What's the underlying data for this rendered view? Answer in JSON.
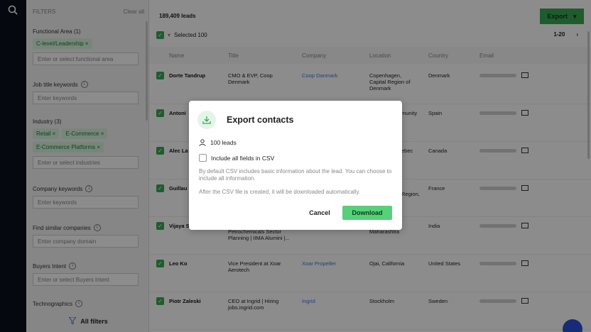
{
  "rail": {
    "icon": "search-icon"
  },
  "filters": {
    "title": "FILTERS",
    "clear_all": "Clear all",
    "functional_area": {
      "label": "Functional Area (1)",
      "chips": [
        "C-level/Leadership"
      ],
      "placeholder": "Enter or select functional area"
    },
    "job_title": {
      "label": "Job title keywords",
      "placeholder": "Enter keywords"
    },
    "industry": {
      "label": "Industry (3)",
      "chips": [
        "Retail",
        "E-Commerce",
        "E-Commerce Platforms"
      ],
      "placeholder": "Enter or select industries"
    },
    "company_keywords": {
      "label": "Company keywords",
      "placeholder": "Enter keywords"
    },
    "similar_companies": {
      "label": "Find similar companies",
      "placeholder": "Enter company domain"
    },
    "buyers_intent": {
      "label": "Buyers Intent",
      "placeholder": "Enter or select Buyers Intent"
    },
    "technographics": {
      "label": "Technographics"
    },
    "all_filters": "All filters"
  },
  "main": {
    "lead_count": "189,409 leads",
    "export_label": "Export",
    "selected_label": "Selected 100",
    "pager": "1-20",
    "columns": [
      "Name",
      "Title",
      "Company",
      "Location",
      "Country",
      "Email"
    ],
    "rows": [
      {
        "name": "Dorte Tandrup",
        "title": "CMO & EVP, Coop Denmark",
        "company": "Coop Danmark",
        "location": "Copenhagen, Capital Region of Denmark",
        "country": "Denmark"
      },
      {
        "name": "Antoni",
        "title": "",
        "company": "",
        "location": "munity",
        "country": "Spain"
      },
      {
        "name": "Alec La",
        "title": "",
        "company": "",
        "location": "ebec",
        "country": "Canada"
      },
      {
        "name": "Guillau",
        "title": "",
        "company": "",
        "location": "Region,",
        "country": "France"
      },
      {
        "name": "Vijaya S",
        "title": "Petrochemicals Sector Planning | IIMA Alumini |...",
        "company": "",
        "location": "Maharashtra",
        "country": "India"
      },
      {
        "name": "Leo Ko",
        "title": "Vice President at Xoar Aerotech",
        "company": "Xoar Propeller",
        "location": "Ojai, California",
        "country": "United States"
      },
      {
        "name": "Piotr Zaleski",
        "title": "CEO at Ingrid | Hiring jobs.ingrid.com",
        "company": "Ingrid",
        "location": "Stockholm",
        "country": "Sweden"
      }
    ]
  },
  "modal": {
    "title": "Export contacts",
    "leads": "100 leads",
    "include_all": "Include all fields in CSV",
    "description": "By default CSV includes basic information about the lead. You can choose to include all information.",
    "note": "After the CSV file is created, it will be downloaded automatically.",
    "cancel": "Cancel",
    "download": "Download"
  },
  "colors": {
    "accent": "#3aa853",
    "download_button": "#56d07a",
    "chip_bg": "#d9f5df",
    "link": "#3b7bd6"
  }
}
